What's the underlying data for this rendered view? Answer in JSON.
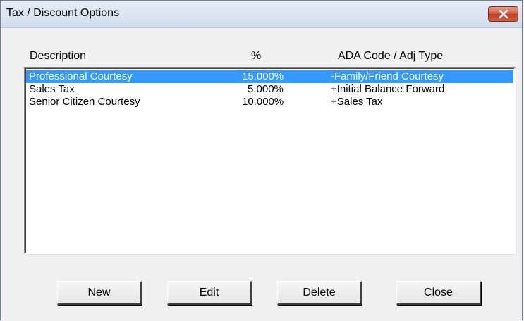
{
  "window": {
    "title": "Tax / Discount Options"
  },
  "columns": {
    "description": "Description",
    "percent": "%",
    "ada_code": "ADA Code / Adj Type"
  },
  "rows": [
    {
      "description": "Professional Courtesy",
      "percent": "15.000%",
      "ada_code": "-Family/Friend Courtesy",
      "selected": true
    },
    {
      "description": "Sales Tax",
      "percent": "5.000%",
      "ada_code": "+Initial Balance Forward",
      "selected": false
    },
    {
      "description": "Senior Citizen Courtesy",
      "percent": "10.000%",
      "ada_code": "+Sales Tax",
      "selected": false
    }
  ],
  "buttons": {
    "new": "New",
    "edit": "Edit",
    "delete": "Delete",
    "close": "Close"
  },
  "colors": {
    "selection": "#3399ff",
    "close_button": "#c0391d"
  }
}
